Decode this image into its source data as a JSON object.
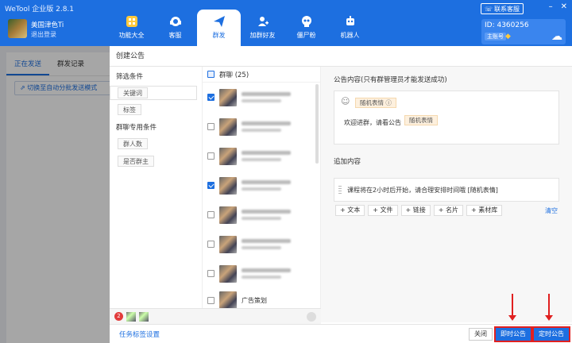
{
  "app": {
    "title": "WeTool 企业版 2.8.1"
  },
  "user": {
    "name": "美国津色Ti",
    "status": "退出登录"
  },
  "nav": [
    {
      "label": "功能大全",
      "icon": "grid-icon"
    },
    {
      "label": "客服",
      "icon": "headset-icon"
    },
    {
      "label": "群发",
      "icon": "send-icon"
    },
    {
      "label": "加群好友",
      "icon": "add-user-icon"
    },
    {
      "label": "僵尸粉",
      "icon": "skull-icon"
    },
    {
      "label": "机器人",
      "icon": "robot-icon"
    }
  ],
  "header": {
    "support": "联系客服",
    "id_label": "ID: 4360256",
    "main_badge": "主账号"
  },
  "left": {
    "tab_sending": "正在发送",
    "tab_records": "群发记录",
    "auto_mode": "切换至自动分批发送模式"
  },
  "dialog": {
    "title": "创建公告",
    "filter": {
      "heading": "筛选条件",
      "keyword": "关键词",
      "tag": "标签",
      "group_heading": "群聊专用条件",
      "members": "群人数",
      "is_owner": "是否群主"
    },
    "list": {
      "header": "群聊 (25)",
      "last_group": "广告策划"
    },
    "content": {
      "heading": "公告内容(只有群管理员才能发送成功)",
      "random_tag": "随机表情",
      "text": "欢迎进群，请看公告",
      "random_tag2": "随机表情"
    },
    "append": {
      "heading": "追加内容",
      "text": "课程将在2小时后开始，请合理安排时间哦 [随机表情]",
      "buttons": [
        "+ 文本",
        "+ 文件",
        "+ 链接",
        "+ 名片",
        "+ 素材库"
      ],
      "clear": "清空"
    },
    "selected_count": "2",
    "footer": {
      "tag_settings": "任务标签设置",
      "close": "关闭",
      "instant": "即时公告",
      "timed": "定时公告"
    }
  }
}
